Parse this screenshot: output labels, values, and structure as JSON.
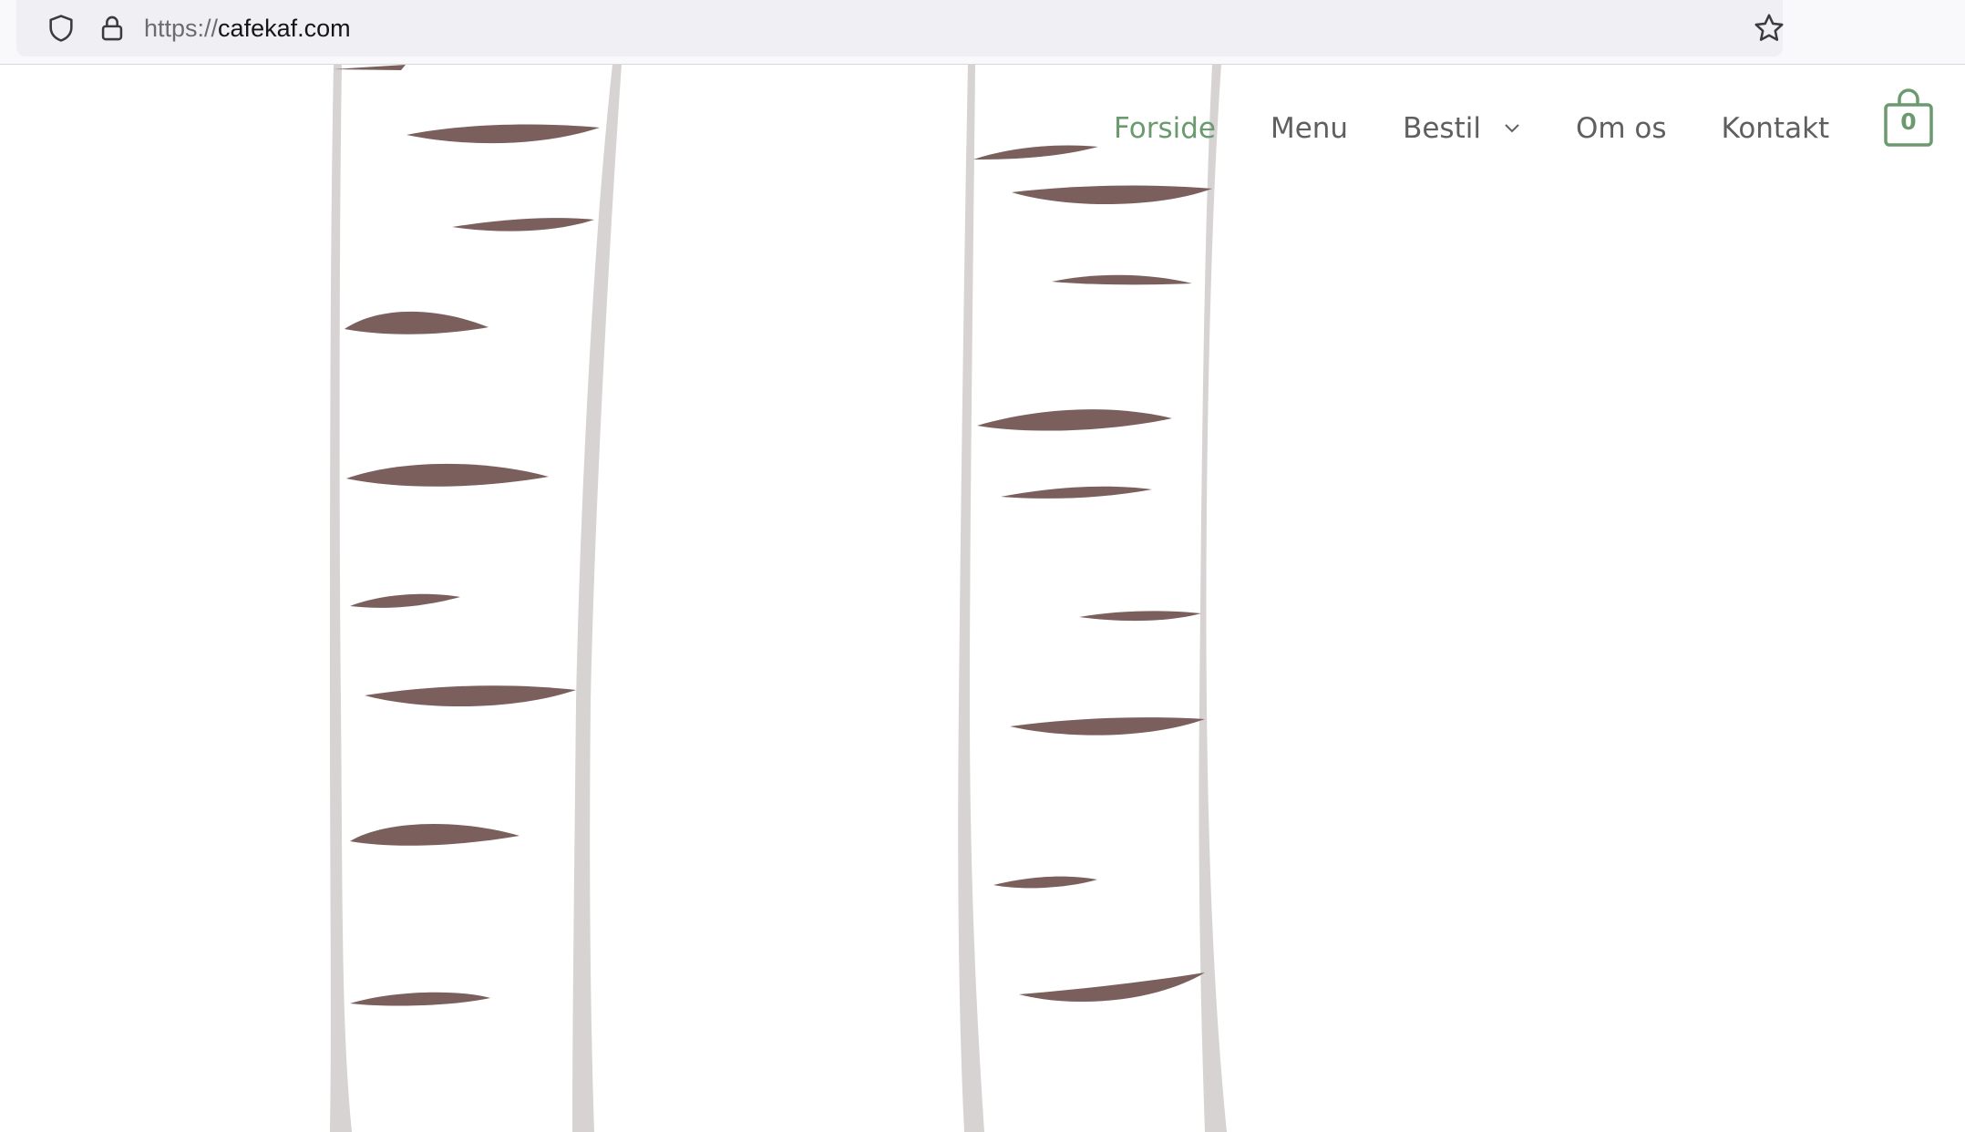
{
  "browser": {
    "url_scheme": "https://",
    "url_host": "cafekaf.com",
    "icons": [
      "shield-icon",
      "lock-icon",
      "star-icon"
    ]
  },
  "nav": {
    "items": [
      {
        "label": "Forside",
        "active": true
      },
      {
        "label": "Menu"
      },
      {
        "label": "Bestil",
        "has_dropdown": true
      },
      {
        "label": "Om os"
      },
      {
        "label": "Kontakt"
      }
    ],
    "cart_count": "0"
  },
  "colors": {
    "accent_green": "#6a9a6e",
    "nav_text": "#5f5f5f",
    "birch_bark": "#d6d3d2",
    "birch_mark": "#7a5f5c"
  }
}
